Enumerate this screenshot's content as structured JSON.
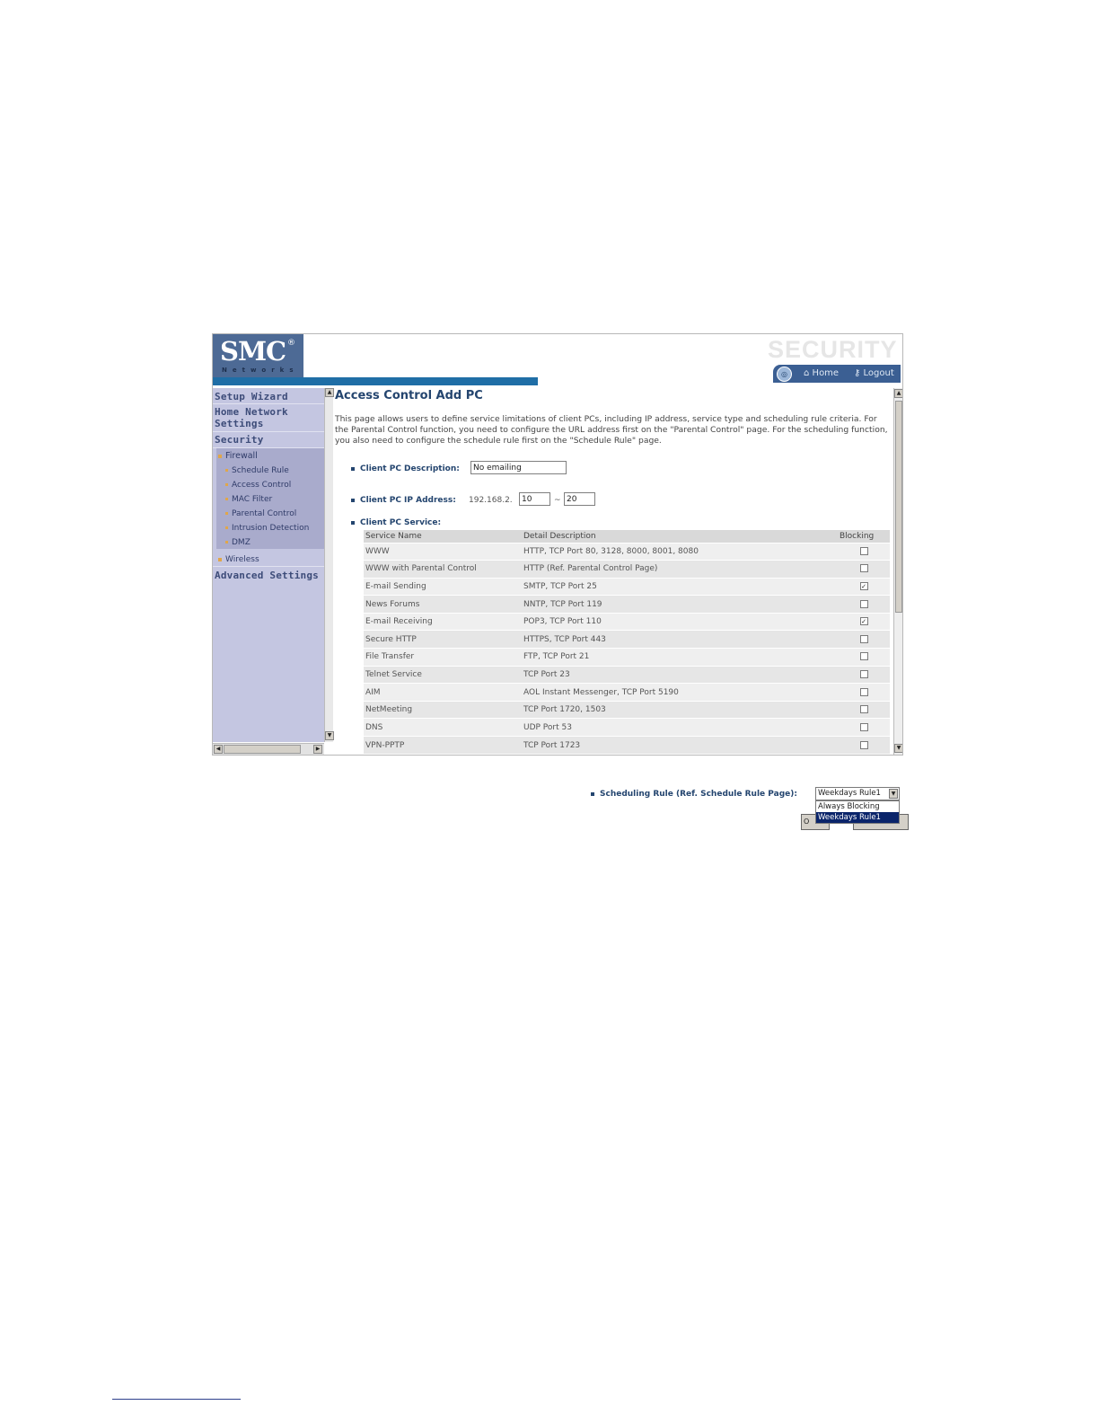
{
  "header": {
    "logo": "SMC",
    "logo_mark": "®",
    "logo_sub": "Networks",
    "section_banner": "SECURITY",
    "home_link": "Home",
    "logout_link": "Logout",
    "icons": {
      "globe": "globe-icon",
      "home": "house-icon",
      "logout": "key-icon"
    }
  },
  "sidebar": {
    "items": [
      {
        "label": "Setup Wizard"
      },
      {
        "label": "Home Network Settings"
      },
      {
        "label": "Security"
      },
      {
        "label": "Advanced Settings"
      }
    ],
    "firewall": {
      "label": "Firewall",
      "children": [
        "Schedule Rule",
        "Access Control",
        "MAC Filter",
        "Parental Control",
        "Intrusion Detection",
        "DMZ"
      ]
    },
    "wireless": "Wireless"
  },
  "main": {
    "title": "Access Control Add PC",
    "description": "This page allows users to define service limitations of client PCs, including IP address, service type and scheduling rule criteria. For the Parental Control function, you need to configure the URL address first on the \"Parental Control\" page. For the scheduling function, you also need to configure the schedule rule first on the \"Schedule Rule\" page.",
    "client_desc_label": "Client PC Description:",
    "client_desc_value": "No emailing",
    "client_ip_label": "Client PC IP Address:",
    "client_ip_prefix": "192.168.2.",
    "client_ip_start": "10",
    "client_ip_dash": "~",
    "client_ip_end": "20",
    "service_label": "Client PC Service:",
    "table": {
      "headers": [
        "Service Name",
        "Detail Description",
        "Blocking"
      ],
      "rows": [
        {
          "name": "WWW",
          "desc": "HTTP, TCP Port 80, 3128, 8000, 8001, 8080",
          "blocked": false
        },
        {
          "name": "WWW with Parental Control",
          "desc": "HTTP (Ref. Parental Control Page)",
          "blocked": false
        },
        {
          "name": "E-mail Sending",
          "desc": "SMTP, TCP Port 25",
          "blocked": true
        },
        {
          "name": "News Forums",
          "desc": "NNTP, TCP Port 119",
          "blocked": false
        },
        {
          "name": "E-mail Receiving",
          "desc": "POP3, TCP Port 110",
          "blocked": true
        },
        {
          "name": "Secure HTTP",
          "desc": "HTTPS, TCP Port 443",
          "blocked": false
        },
        {
          "name": "File Transfer",
          "desc": "FTP, TCP Port 21",
          "blocked": false
        },
        {
          "name": "Telnet Service",
          "desc": "TCP Port 23",
          "blocked": false
        },
        {
          "name": "AIM",
          "desc": "AOL Instant Messenger, TCP Port 5190",
          "blocked": false
        },
        {
          "name": "NetMeeting",
          "desc": "TCP Port 1720, 1503",
          "blocked": false
        },
        {
          "name": "DNS",
          "desc": "UDP Port 53",
          "blocked": false
        },
        {
          "name": "VPN-PPTP",
          "desc": "TCP Port 1723",
          "blocked": false
        }
      ]
    }
  },
  "scheduling": {
    "label": "Scheduling Rule (Ref. Schedule Rule Page):",
    "selected": "Weekdays Rule1",
    "options": [
      "Always Blocking",
      "Weekdays Rule1"
    ],
    "highlighted_option": "Weekdays Rule1",
    "button_partial": "O"
  },
  "colors": {
    "logo_bg": "#4d6a95",
    "accent_bar": "#1f6ea6",
    "sidebar_bg": "#c4c6e1",
    "title_text": "#24456f",
    "selection": "#0a246a"
  }
}
